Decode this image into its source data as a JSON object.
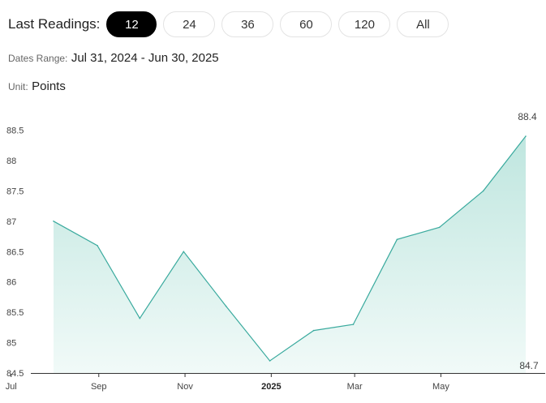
{
  "controls": {
    "label": "Last Readings:",
    "options": [
      "12",
      "24",
      "36",
      "60",
      "120",
      "All"
    ],
    "active_index": 0
  },
  "meta": {
    "dates_label": "Dates Range:",
    "dates_value": "Jul 31, 2024 - Jun 30, 2025",
    "unit_label": "Unit:",
    "unit_value": "Points"
  },
  "colors": {
    "line": "#3aaa9e",
    "fill_top": "#bfe6df",
    "fill_bottom": "#f1faf8",
    "active_pill": "#000000"
  },
  "chart_data": {
    "type": "area",
    "x": [
      "2024-07-31",
      "2024-08-31",
      "2024-09-30",
      "2024-10-31",
      "2024-11-30",
      "2024-12-31",
      "2025-01-31",
      "2025-02-28",
      "2025-03-31",
      "2025-04-30",
      "2025-05-31",
      "2025-06-30"
    ],
    "values": [
      87.0,
      86.6,
      85.4,
      86.5,
      85.6,
      84.7,
      85.2,
      85.3,
      86.7,
      86.9,
      87.5,
      88.4
    ],
    "yticks": [
      "84.5",
      "85",
      "85.5",
      "86",
      "86.5",
      "87",
      "87.5",
      "88",
      "88.5"
    ],
    "ylim": [
      84.5,
      88.8
    ],
    "xticks": [
      {
        "label": "Jul",
        "date": "2024-07-01"
      },
      {
        "label": "Sep",
        "date": "2024-09-01"
      },
      {
        "label": "Nov",
        "date": "2024-11-01"
      },
      {
        "label": "2025",
        "date": "2025-01-01",
        "bold": true
      },
      {
        "label": "Mar",
        "date": "2025-03-01"
      },
      {
        "label": "May",
        "date": "2025-05-01"
      }
    ],
    "end_labels": {
      "max": "88.4",
      "min": "84.7"
    },
    "grid": false,
    "legend": "none"
  }
}
